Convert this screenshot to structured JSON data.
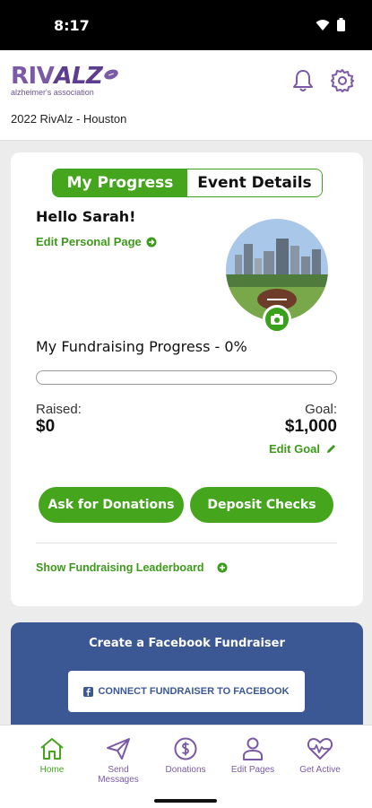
{
  "status_bar": {
    "time": "8:17"
  },
  "header": {
    "logo_main_1": "RIV",
    "logo_main_2": "ALZ",
    "logo_sub": "alzheimer's association",
    "event_name": "2022 RivAlz - Houston"
  },
  "tabs": [
    {
      "label": "My Progress",
      "active": true
    },
    {
      "label": "Event Details",
      "active": false
    }
  ],
  "profile": {
    "greeting": "Hello Sarah!",
    "edit_personal_page": "Edit Personal Page"
  },
  "fundraising": {
    "progress_label": "My Fundraising Progress - 0%",
    "progress_fraction": 0,
    "raised_label": "Raised:",
    "raised_value": "$0",
    "goal_label": "Goal:",
    "goal_value": "$1,000",
    "edit_goal": "Edit Goal"
  },
  "actions": {
    "ask_donations": "Ask for Donations",
    "deposit_checks": "Deposit Checks",
    "leaderboard": "Show Fundraising Leaderboard"
  },
  "facebook": {
    "title": "Create a Facebook Fundraiser",
    "button": "CONNECT FUNDRAISER TO FACEBOOK"
  },
  "bottom_nav": [
    {
      "label": "Home",
      "icon": "home-icon",
      "active": true
    },
    {
      "label": "Send\nMessages",
      "icon": "send-icon",
      "active": false
    },
    {
      "label": "Donations",
      "icon": "dollar-icon",
      "active": false
    },
    {
      "label": "Edit Pages",
      "icon": "person-icon",
      "active": false
    },
    {
      "label": "Get Active",
      "icon": "heart-pulse-icon",
      "active": false
    }
  ],
  "colors": {
    "green": "#45a51d",
    "purple": "#7a5aa6",
    "facebook_blue": "#3b5895"
  }
}
